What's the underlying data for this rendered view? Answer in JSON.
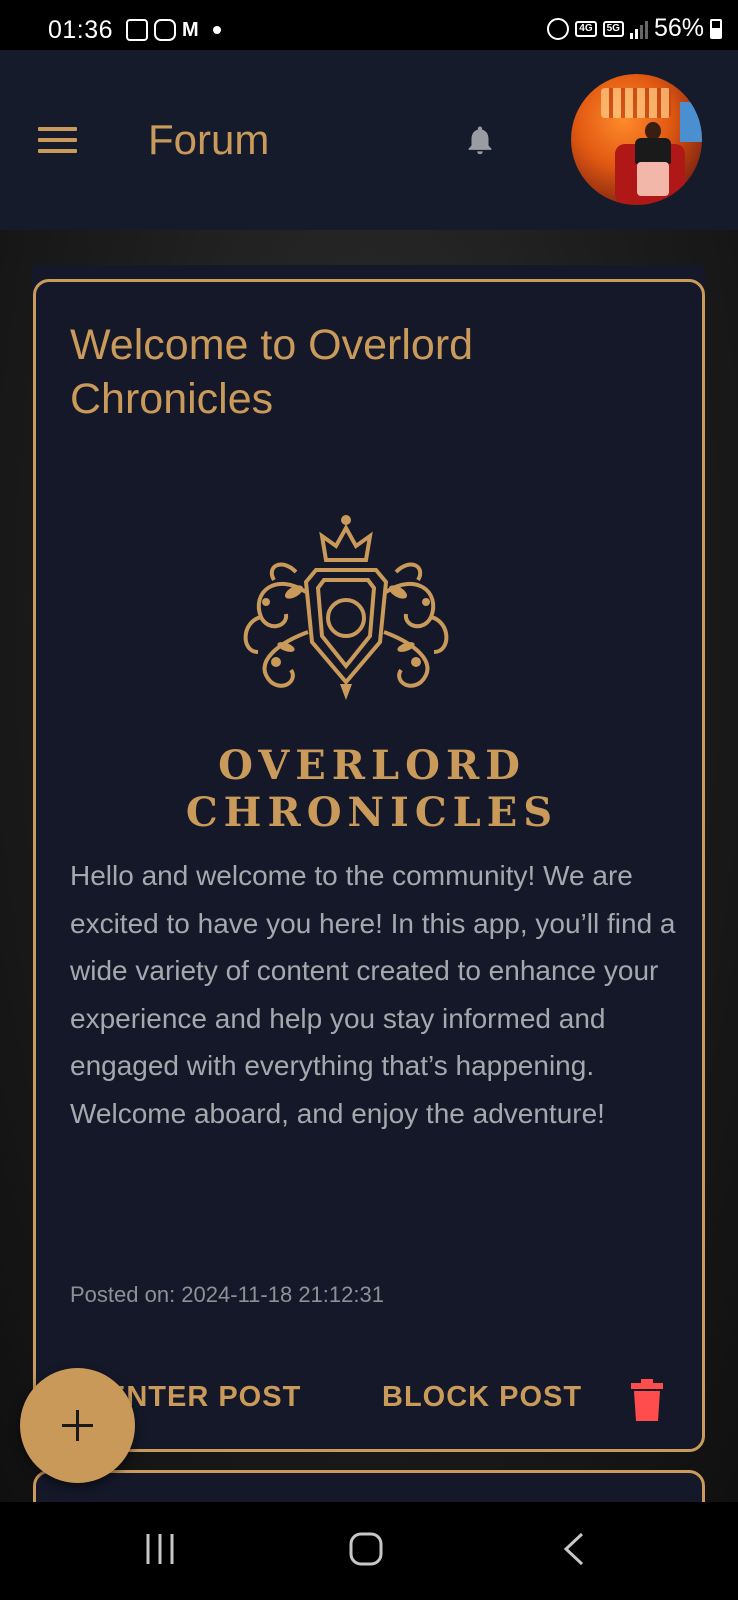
{
  "status_bar": {
    "time": "01:36",
    "network": "5G",
    "volte": "VoLTE 4G",
    "battery": "56%",
    "battery_level": 0.56
  },
  "app_bar": {
    "title": "Forum",
    "menu_icon": "hamburger-menu-icon",
    "notification_icon": "bell-icon",
    "avatar": "user-avatar"
  },
  "post": {
    "title": "Welcome to Overlord Chronicles",
    "logo_text": "OVERLORD CHRONICLES",
    "body": "Hello and welcome to the community! We are excited to have you here! In this app, you’ll find a wide variety of content created to enhance your experience and help you stay informed and engaged with everything that’s happening. Welcome aboard, and enjoy the adventure!",
    "posted": "Posted on: 2024-11-18 21:12:31",
    "enter_label": "ENTER POST",
    "block_label": "BLOCK POST",
    "delete_icon": "trash-icon"
  },
  "fab": {
    "icon": "plus-icon"
  },
  "colors": {
    "accent": "#c99a5a",
    "app_bar_bg": "#161b2c",
    "card_bg": "#141828",
    "delete": "#ff4d4d",
    "body_text": "#a7a8ae"
  },
  "nav": {
    "recents_icon": "recent-apps-icon",
    "home_icon": "home-icon",
    "back_icon": "back-icon"
  }
}
